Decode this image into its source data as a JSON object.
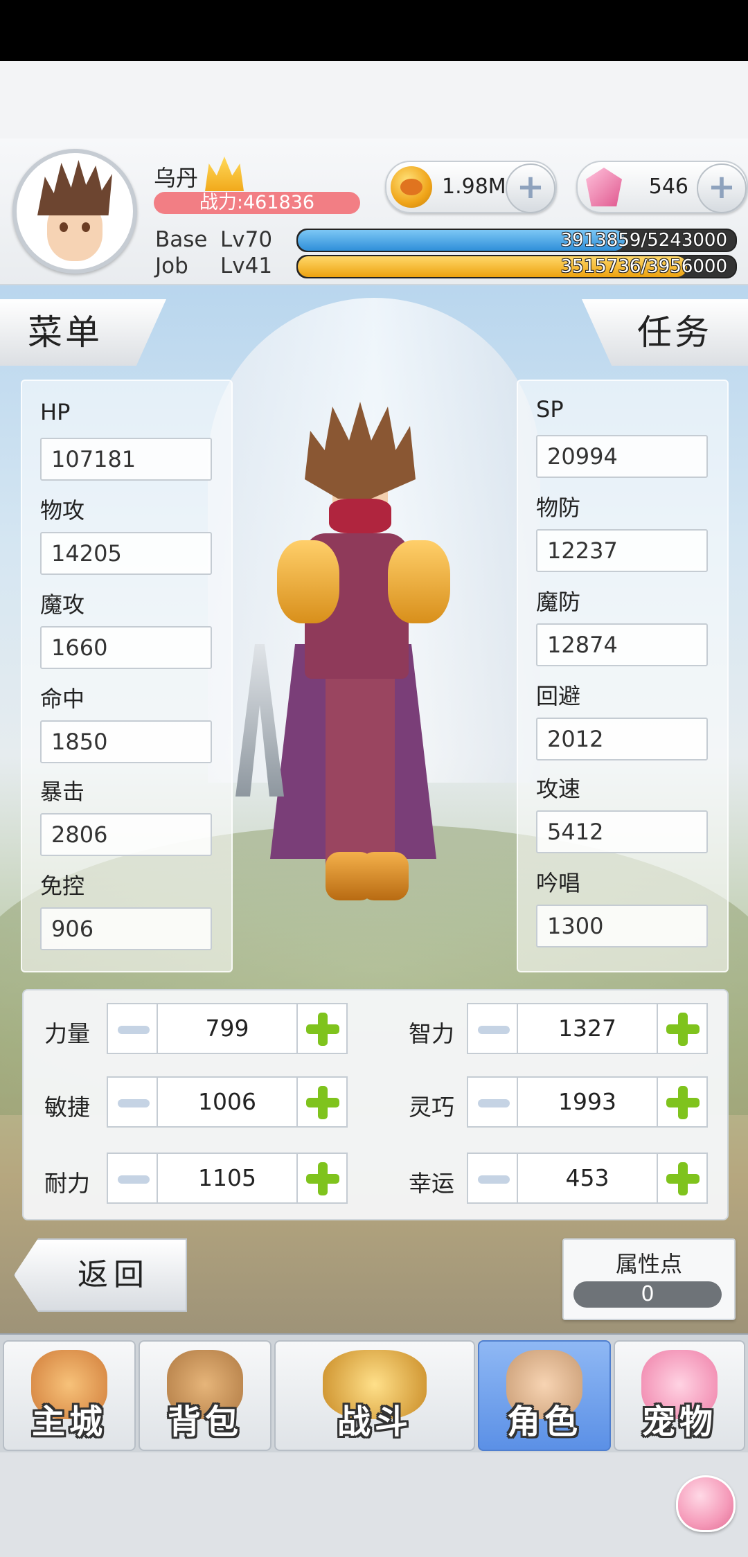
{
  "player": {
    "name": "乌丹",
    "power": "战力:461836",
    "base_label": "Base",
    "base_level": "Lv70",
    "base_exp_text": "3913859/5243000",
    "base_exp_fraction": 0.7465,
    "job_label": "Job",
    "job_level": "Lv41",
    "job_exp_text": "3515736/3956000",
    "job_exp_fraction": 0.8887
  },
  "currency": {
    "zeny": "1.98M",
    "gems": "546"
  },
  "tabs": {
    "menu": "菜单",
    "task": "任务"
  },
  "stats_left": [
    {
      "label": "HP",
      "value": "107181"
    },
    {
      "label": "物攻",
      "value": "14205"
    },
    {
      "label": "魔攻",
      "value": "1660"
    },
    {
      "label": "命中",
      "value": "1850"
    },
    {
      "label": "暴击",
      "value": "2806"
    },
    {
      "label": "免控",
      "value": "906"
    }
  ],
  "stats_right": [
    {
      "label": "SP",
      "value": "20994"
    },
    {
      "label": "物防",
      "value": "12237"
    },
    {
      "label": "魔防",
      "value": "12874"
    },
    {
      "label": "回避",
      "value": "2012"
    },
    {
      "label": "攻速",
      "value": "5412"
    },
    {
      "label": "吟唱",
      "value": "1300"
    }
  ],
  "attributes": [
    {
      "label": "力量",
      "value": "799"
    },
    {
      "label": "智力",
      "value": "1327"
    },
    {
      "label": "敏捷",
      "value": "1006"
    },
    {
      "label": "灵巧",
      "value": "1993"
    },
    {
      "label": "耐力",
      "value": "1105"
    },
    {
      "label": "幸运",
      "value": "453"
    }
  ],
  "back_label": "返回",
  "attr_points": {
    "title": "属性点",
    "value": "0"
  },
  "nav": [
    {
      "label": "主城",
      "icon": "castle-icon"
    },
    {
      "label": "背包",
      "icon": "backpack-icon"
    },
    {
      "label": "战斗",
      "icon": "battle-icon"
    },
    {
      "label": "角色",
      "icon": "character-icon",
      "active": true
    },
    {
      "label": "宠物",
      "icon": "pet-icon"
    }
  ],
  "colors": {
    "base_exp": "#3aa0e8",
    "job_exp": "#f5b833",
    "power_bar": "#f27e84",
    "active_tab": "#6a9ceb",
    "plus_green": "#7fc31d"
  }
}
